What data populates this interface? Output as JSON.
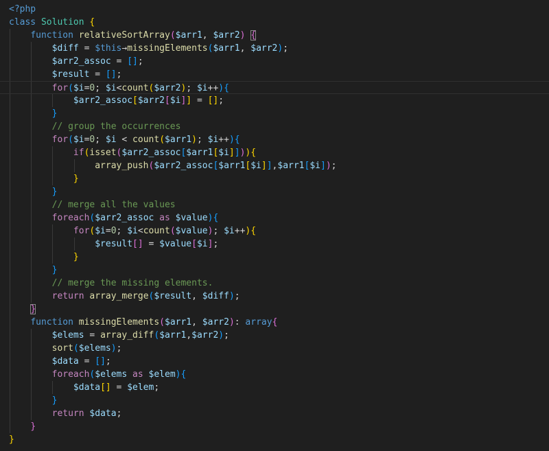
{
  "colors": {
    "background": "#1f1f1f",
    "plain": "#d4d4d4",
    "keyword": "#569cd6",
    "control": "#c586c0",
    "function": "#dcdcaa",
    "variable": "#9cdcfe",
    "class": "#4ec9b0",
    "comment": "#6a9955",
    "number": "#b5cea8",
    "bracket1": "#ffd700",
    "bracket2": "#da70d6",
    "bracket3": "#179fff"
  },
  "code_lines": [
    {
      "indent": 0,
      "tokens": [
        {
          "t": "<?php",
          "c": "keyword"
        }
      ]
    },
    {
      "indent": 0,
      "tokens": [
        {
          "t": "class ",
          "c": "keyword"
        },
        {
          "t": "Solution",
          "c": "class"
        },
        {
          "t": " ",
          "c": "plain"
        },
        {
          "t": "{",
          "c": "bracket1"
        }
      ]
    },
    {
      "indent": 1,
      "tokens": [
        {
          "t": "function ",
          "c": "keyword"
        },
        {
          "t": "relativeSortArray",
          "c": "function"
        },
        {
          "t": "(",
          "c": "bracket2"
        },
        {
          "t": "$arr1",
          "c": "variable"
        },
        {
          "t": ", ",
          "c": "plain"
        },
        {
          "t": "$arr2",
          "c": "variable"
        },
        {
          "t": ")",
          "c": "bracket2"
        },
        {
          "t": " ",
          "c": "plain"
        },
        {
          "t": "{",
          "c": "bracket2",
          "box": true
        }
      ]
    },
    {
      "indent": 2,
      "tokens": [
        {
          "t": "$diff",
          "c": "variable"
        },
        {
          "t": " = ",
          "c": "plain"
        },
        {
          "t": "$this",
          "c": "keyword"
        },
        {
          "t": "→",
          "c": "plain"
        },
        {
          "t": "missingElements",
          "c": "function"
        },
        {
          "t": "(",
          "c": "bracket3"
        },
        {
          "t": "$arr1",
          "c": "variable"
        },
        {
          "t": ", ",
          "c": "plain"
        },
        {
          "t": "$arr2",
          "c": "variable"
        },
        {
          "t": ")",
          "c": "bracket3"
        },
        {
          "t": ";",
          "c": "plain"
        }
      ]
    },
    {
      "indent": 2,
      "tokens": [
        {
          "t": "$arr2_assoc",
          "c": "variable"
        },
        {
          "t": " = ",
          "c": "plain"
        },
        {
          "t": "[]",
          "c": "bracket3"
        },
        {
          "t": ";",
          "c": "plain"
        }
      ]
    },
    {
      "indent": 2,
      "tokens": [
        {
          "t": "$result",
          "c": "variable"
        },
        {
          "t": " = ",
          "c": "plain"
        },
        {
          "t": "[]",
          "c": "bracket3"
        },
        {
          "t": ";",
          "c": "plain"
        }
      ]
    },
    {
      "indent": 2,
      "current": true,
      "tokens": [
        {
          "t": "for",
          "c": "control"
        },
        {
          "t": "(",
          "c": "bracket3"
        },
        {
          "t": "$i",
          "c": "variable"
        },
        {
          "t": "=",
          "c": "plain"
        },
        {
          "t": "0",
          "c": "number"
        },
        {
          "t": "; ",
          "c": "plain"
        },
        {
          "t": "$i",
          "c": "variable"
        },
        {
          "t": "<",
          "c": "plain"
        },
        {
          "t": "count",
          "c": "function"
        },
        {
          "t": "(",
          "c": "bracket1"
        },
        {
          "t": "$arr2",
          "c": "variable"
        },
        {
          "t": ")",
          "c": "bracket1"
        },
        {
          "t": "; ",
          "c": "plain"
        },
        {
          "t": "$i",
          "c": "variable"
        },
        {
          "t": "++",
          "c": "plain"
        },
        {
          "t": ")",
          "c": "bracket3"
        },
        {
          "t": "{",
          "c": "bracket3"
        }
      ]
    },
    {
      "indent": 3,
      "tokens": [
        {
          "t": "$arr2_assoc",
          "c": "variable"
        },
        {
          "t": "[",
          "c": "bracket1"
        },
        {
          "t": "$arr2",
          "c": "variable"
        },
        {
          "t": "[",
          "c": "bracket2"
        },
        {
          "t": "$i",
          "c": "variable"
        },
        {
          "t": "]",
          "c": "bracket2"
        },
        {
          "t": "]",
          "c": "bracket1"
        },
        {
          "t": " = ",
          "c": "plain"
        },
        {
          "t": "[]",
          "c": "bracket1"
        },
        {
          "t": ";",
          "c": "plain"
        }
      ]
    },
    {
      "indent": 2,
      "tokens": [
        {
          "t": "}",
          "c": "bracket3"
        }
      ]
    },
    {
      "indent": 2,
      "tokens": [
        {
          "t": "// group the occurrences",
          "c": "comment"
        }
      ]
    },
    {
      "indent": 2,
      "tokens": [
        {
          "t": "for",
          "c": "control"
        },
        {
          "t": "(",
          "c": "bracket3"
        },
        {
          "t": "$i",
          "c": "variable"
        },
        {
          "t": "=",
          "c": "plain"
        },
        {
          "t": "0",
          "c": "number"
        },
        {
          "t": "; ",
          "c": "plain"
        },
        {
          "t": "$i",
          "c": "variable"
        },
        {
          "t": " < ",
          "c": "plain"
        },
        {
          "t": "count",
          "c": "function"
        },
        {
          "t": "(",
          "c": "bracket1"
        },
        {
          "t": "$arr1",
          "c": "variable"
        },
        {
          "t": ")",
          "c": "bracket1"
        },
        {
          "t": "; ",
          "c": "plain"
        },
        {
          "t": "$i",
          "c": "variable"
        },
        {
          "t": "++",
          "c": "plain"
        },
        {
          "t": ")",
          "c": "bracket3"
        },
        {
          "t": "{",
          "c": "bracket3"
        }
      ]
    },
    {
      "indent": 3,
      "tokens": [
        {
          "t": "if",
          "c": "control"
        },
        {
          "t": "(",
          "c": "bracket1"
        },
        {
          "t": "isset",
          "c": "function"
        },
        {
          "t": "(",
          "c": "bracket2"
        },
        {
          "t": "$arr2_assoc",
          "c": "variable"
        },
        {
          "t": "[",
          "c": "bracket3"
        },
        {
          "t": "$arr1",
          "c": "variable"
        },
        {
          "t": "[",
          "c": "bracket1"
        },
        {
          "t": "$i",
          "c": "variable"
        },
        {
          "t": "]",
          "c": "bracket1"
        },
        {
          "t": "]",
          "c": "bracket3"
        },
        {
          "t": ")",
          "c": "bracket2"
        },
        {
          "t": ")",
          "c": "bracket1"
        },
        {
          "t": "{",
          "c": "bracket1"
        }
      ]
    },
    {
      "indent": 4,
      "tokens": [
        {
          "t": "array_push",
          "c": "function"
        },
        {
          "t": "(",
          "c": "bracket2"
        },
        {
          "t": "$arr2_assoc",
          "c": "variable"
        },
        {
          "t": "[",
          "c": "bracket3"
        },
        {
          "t": "$arr1",
          "c": "variable"
        },
        {
          "t": "[",
          "c": "bracket1"
        },
        {
          "t": "$i",
          "c": "variable"
        },
        {
          "t": "]",
          "c": "bracket1"
        },
        {
          "t": "]",
          "c": "bracket3"
        },
        {
          "t": ",",
          "c": "plain"
        },
        {
          "t": "$arr1",
          "c": "variable"
        },
        {
          "t": "[",
          "c": "bracket3"
        },
        {
          "t": "$i",
          "c": "variable"
        },
        {
          "t": "]",
          "c": "bracket3"
        },
        {
          "t": ")",
          "c": "bracket2"
        },
        {
          "t": ";",
          "c": "plain"
        }
      ]
    },
    {
      "indent": 3,
      "tokens": [
        {
          "t": "}",
          "c": "bracket1"
        }
      ]
    },
    {
      "indent": 2,
      "tokens": [
        {
          "t": "}",
          "c": "bracket3"
        }
      ]
    },
    {
      "indent": 2,
      "tokens": [
        {
          "t": "// merge all the values",
          "c": "comment"
        }
      ]
    },
    {
      "indent": 2,
      "tokens": [
        {
          "t": "foreach",
          "c": "control"
        },
        {
          "t": "(",
          "c": "bracket3"
        },
        {
          "t": "$arr2_assoc",
          "c": "variable"
        },
        {
          "t": " as ",
          "c": "control"
        },
        {
          "t": "$value",
          "c": "variable"
        },
        {
          "t": ")",
          "c": "bracket3"
        },
        {
          "t": "{",
          "c": "bracket3"
        }
      ]
    },
    {
      "indent": 3,
      "tokens": [
        {
          "t": "for",
          "c": "control"
        },
        {
          "t": "(",
          "c": "bracket1"
        },
        {
          "t": "$i",
          "c": "variable"
        },
        {
          "t": "=",
          "c": "plain"
        },
        {
          "t": "0",
          "c": "number"
        },
        {
          "t": "; ",
          "c": "plain"
        },
        {
          "t": "$i",
          "c": "variable"
        },
        {
          "t": "<",
          "c": "plain"
        },
        {
          "t": "count",
          "c": "function"
        },
        {
          "t": "(",
          "c": "bracket2"
        },
        {
          "t": "$value",
          "c": "variable"
        },
        {
          "t": ")",
          "c": "bracket2"
        },
        {
          "t": "; ",
          "c": "plain"
        },
        {
          "t": "$i",
          "c": "variable"
        },
        {
          "t": "++",
          "c": "plain"
        },
        {
          "t": ")",
          "c": "bracket1"
        },
        {
          "t": "{",
          "c": "bracket1"
        }
      ]
    },
    {
      "indent": 4,
      "tokens": [
        {
          "t": "$result",
          "c": "variable"
        },
        {
          "t": "[]",
          "c": "bracket2"
        },
        {
          "t": " = ",
          "c": "plain"
        },
        {
          "t": "$value",
          "c": "variable"
        },
        {
          "t": "[",
          "c": "bracket2"
        },
        {
          "t": "$i",
          "c": "variable"
        },
        {
          "t": "]",
          "c": "bracket2"
        },
        {
          "t": ";",
          "c": "plain"
        }
      ]
    },
    {
      "indent": 3,
      "tokens": [
        {
          "t": "}",
          "c": "bracket1"
        }
      ]
    },
    {
      "indent": 2,
      "tokens": [
        {
          "t": "}",
          "c": "bracket3"
        }
      ]
    },
    {
      "indent": 2,
      "tokens": [
        {
          "t": "// merge the missing elements.",
          "c": "comment"
        }
      ]
    },
    {
      "indent": 2,
      "tokens": [
        {
          "t": "return ",
          "c": "control"
        },
        {
          "t": "array_merge",
          "c": "function"
        },
        {
          "t": "(",
          "c": "bracket3"
        },
        {
          "t": "$result",
          "c": "variable"
        },
        {
          "t": ", ",
          "c": "plain"
        },
        {
          "t": "$diff",
          "c": "variable"
        },
        {
          "t": ")",
          "c": "bracket3"
        },
        {
          "t": ";",
          "c": "plain"
        }
      ]
    },
    {
      "indent": 1,
      "tokens": [
        {
          "t": "}",
          "c": "bracket2",
          "box": true
        }
      ]
    },
    {
      "indent": 1,
      "tokens": [
        {
          "t": "function ",
          "c": "keyword"
        },
        {
          "t": "missingElements",
          "c": "function"
        },
        {
          "t": "(",
          "c": "bracket2"
        },
        {
          "t": "$arr1",
          "c": "variable"
        },
        {
          "t": ", ",
          "c": "plain"
        },
        {
          "t": "$arr2",
          "c": "variable"
        },
        {
          "t": ")",
          "c": "bracket2"
        },
        {
          "t": ": ",
          "c": "plain"
        },
        {
          "t": "array",
          "c": "keyword"
        },
        {
          "t": "{",
          "c": "bracket2"
        }
      ]
    },
    {
      "indent": 2,
      "tokens": [
        {
          "t": "$elems",
          "c": "variable"
        },
        {
          "t": " = ",
          "c": "plain"
        },
        {
          "t": "array_diff",
          "c": "function"
        },
        {
          "t": "(",
          "c": "bracket3"
        },
        {
          "t": "$arr1",
          "c": "variable"
        },
        {
          "t": ",",
          "c": "plain"
        },
        {
          "t": "$arr2",
          "c": "variable"
        },
        {
          "t": ")",
          "c": "bracket3"
        },
        {
          "t": ";",
          "c": "plain"
        }
      ]
    },
    {
      "indent": 2,
      "tokens": [
        {
          "t": "sort",
          "c": "function"
        },
        {
          "t": "(",
          "c": "bracket3"
        },
        {
          "t": "$elems",
          "c": "variable"
        },
        {
          "t": ")",
          "c": "bracket3"
        },
        {
          "t": ";",
          "c": "plain"
        }
      ]
    },
    {
      "indent": 2,
      "tokens": [
        {
          "t": "$data",
          "c": "variable"
        },
        {
          "t": " = ",
          "c": "plain"
        },
        {
          "t": "[]",
          "c": "bracket3"
        },
        {
          "t": ";",
          "c": "plain"
        }
      ]
    },
    {
      "indent": 2,
      "tokens": [
        {
          "t": "foreach",
          "c": "control"
        },
        {
          "t": "(",
          "c": "bracket3"
        },
        {
          "t": "$elems",
          "c": "variable"
        },
        {
          "t": " as ",
          "c": "control"
        },
        {
          "t": "$elem",
          "c": "variable"
        },
        {
          "t": ")",
          "c": "bracket3"
        },
        {
          "t": "{",
          "c": "bracket3"
        }
      ]
    },
    {
      "indent": 3,
      "tokens": [
        {
          "t": "$data",
          "c": "variable"
        },
        {
          "t": "[]",
          "c": "bracket1"
        },
        {
          "t": " = ",
          "c": "plain"
        },
        {
          "t": "$elem",
          "c": "variable"
        },
        {
          "t": ";",
          "c": "plain"
        }
      ]
    },
    {
      "indent": 2,
      "tokens": [
        {
          "t": "}",
          "c": "bracket3"
        }
      ]
    },
    {
      "indent": 2,
      "tokens": [
        {
          "t": "return ",
          "c": "control"
        },
        {
          "t": "$data",
          "c": "variable"
        },
        {
          "t": ";",
          "c": "plain"
        }
      ]
    },
    {
      "indent": 1,
      "tokens": [
        {
          "t": "}",
          "c": "bracket2"
        }
      ]
    },
    {
      "indent": 0,
      "tokens": [
        {
          "t": "}",
          "c": "bracket1"
        }
      ]
    }
  ]
}
